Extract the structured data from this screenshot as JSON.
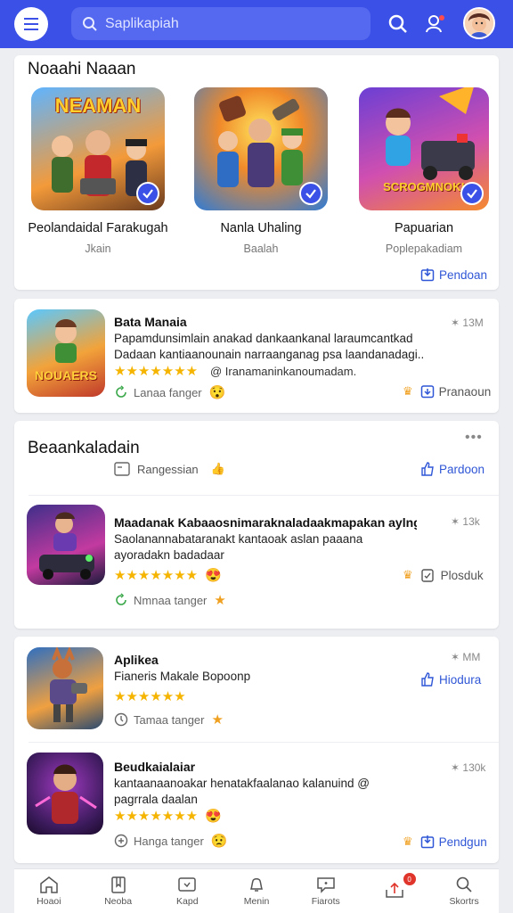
{
  "search": {
    "placeholder": "Saplikapiah"
  },
  "featured": {
    "title": "Noaahi Naaan",
    "items": [
      {
        "thumb_text": "NEAMAN",
        "name": "Peolandaidal Farakugah",
        "sub": "Jkain"
      },
      {
        "thumb_text": "",
        "name": "Nanla Uhaling",
        "sub": "Baalah"
      },
      {
        "thumb_text": "SCROGMNOK!",
        "name": "Papuarian",
        "sub": "Poplepakadiam"
      }
    ],
    "action_label": "Pendoan"
  },
  "app1": {
    "title": "Bata Manaia",
    "desc": "Papamdunsimlain anakad dankaankanal laraumcantkad Dadaan kantiaanounain narraanganag psa laandanadagi..",
    "stars": "★★★★★★★",
    "review": "@ Iranamaninkanoumadam.",
    "meta": "Lanaa fanger",
    "size": "13M",
    "action": "Pranaoun",
    "icon_text": "NOUAERS"
  },
  "section2": {
    "title": "Beaankaladain",
    "tag": "Rangessian",
    "action": "Pardoon",
    "more": "•••"
  },
  "app2": {
    "title": "Maadanak Kabaaosnimaraknaladaakmapakan aylngun",
    "desc": "Saolanannabataranakt kantaoak aslan paaana ayoradakn badadaar",
    "stars": "★★★★★★★",
    "meta": "Nmnaa tanger",
    "size": "13k",
    "action": "Plosduk"
  },
  "app3": {
    "title": "Aplikea",
    "desc": "Fianeris Makale Bopoonp",
    "stars": "★★★★★★",
    "meta": "Tamaa tanger",
    "size": "MM",
    "action": "Hiodura"
  },
  "app4": {
    "title": "Beudkaialaiar",
    "desc": "kantaanaanoakar henatakfaalanao kalanuind @ pagrrala daalan",
    "stars": "★★★★★★★",
    "meta": "Hanga tanger",
    "size": "130k",
    "action": "Pendgun"
  },
  "nav": [
    {
      "label": "Hoaoi",
      "icon": "home-icon"
    },
    {
      "label": "Neoba",
      "icon": "bookmark-icon"
    },
    {
      "label": "Kapd",
      "icon": "card-icon"
    },
    {
      "label": "Menin",
      "icon": "bell-icon"
    },
    {
      "label": "Fiarots",
      "icon": "chat-icon"
    },
    {
      "label": "",
      "icon": "upload-icon",
      "badge": "0"
    },
    {
      "label": "Skortrs",
      "icon": "search-icon"
    }
  ],
  "colors": {
    "brand": "#3b50e6",
    "link": "#2f56d6",
    "star": "#f5b400"
  }
}
